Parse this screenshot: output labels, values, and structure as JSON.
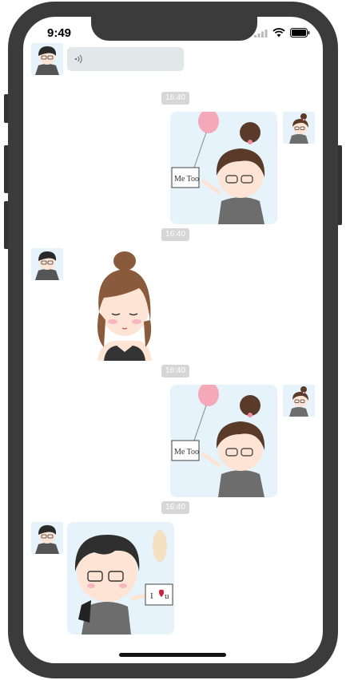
{
  "status_bar": {
    "time": "9:49",
    "icons": [
      "signal-icon",
      "wifi-icon",
      "battery-icon"
    ]
  },
  "messages": [
    {
      "type": "voice",
      "side": "left",
      "avatar": "boy-avatar"
    },
    {
      "timestamp": "16:40",
      "type": "image",
      "side": "right",
      "image": "girl-me-too-sticker",
      "avatar": "girl-avatar"
    },
    {
      "timestamp": "16:40",
      "type": "image",
      "side": "left",
      "image": "shy-girl-sticker",
      "avatar": "boy-avatar"
    },
    {
      "timestamp": "16:40",
      "type": "image",
      "side": "right",
      "image": "girl-me-too-sticker",
      "avatar": "girl-avatar"
    },
    {
      "timestamp": "16:40",
      "type": "image",
      "side": "left",
      "image": "boy-i-love-u-sticker",
      "avatar": "boy-avatar"
    }
  ],
  "sticker_text": {
    "me_too": "Me Too",
    "i_love_u_i": "I",
    "i_love_u_u": "u"
  },
  "colors": {
    "frame": "#3b3b3b",
    "voice_bubble": "#e2e8ea",
    "timestamp_bg": "#d6d6d6",
    "sticker_bg": "#e6f3fb"
  }
}
